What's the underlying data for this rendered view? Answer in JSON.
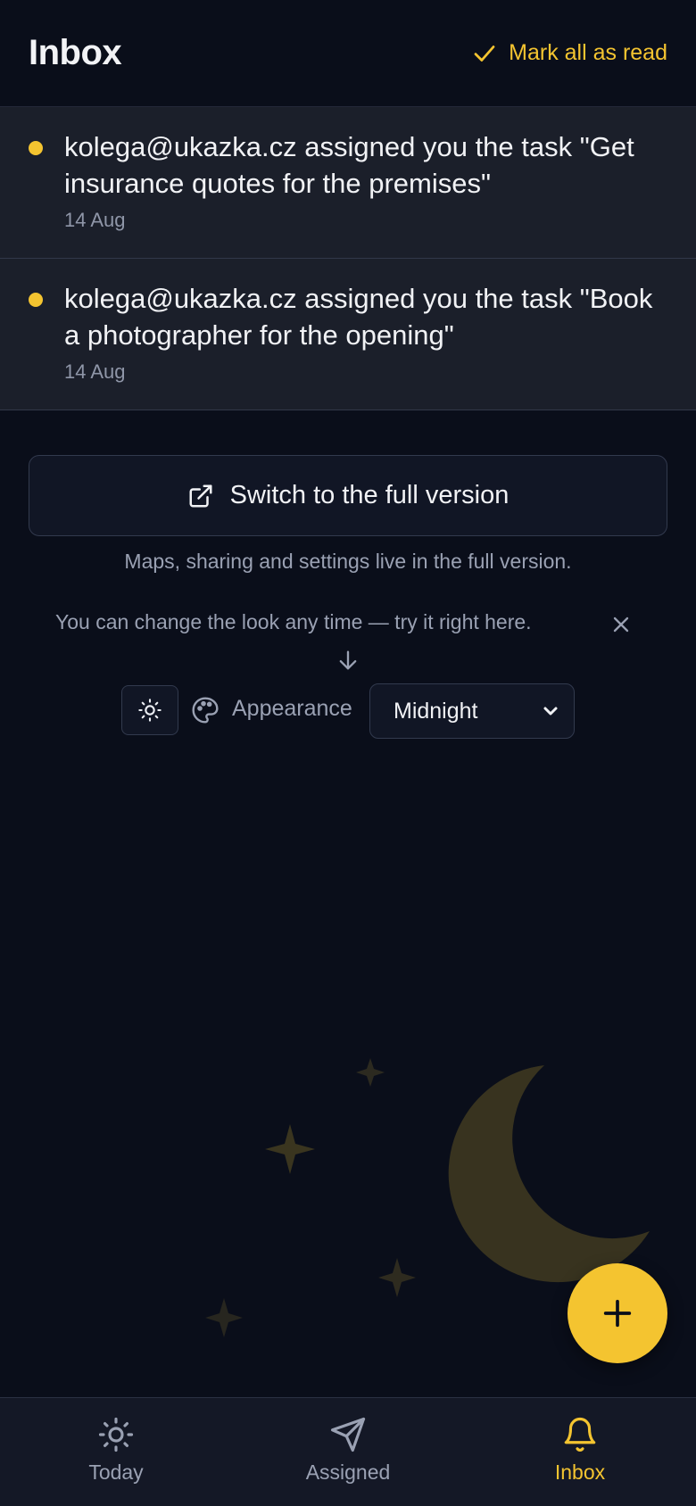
{
  "header": {
    "title": "Inbox",
    "mark_all_label": "Mark all as read"
  },
  "notifications": [
    {
      "text": "kolega@ukazka.cz assigned you the task \"Get insurance quotes for the premises\"",
      "date": "14 Aug",
      "unread": true
    },
    {
      "text": "kolega@ukazka.cz assigned you the task \"Book a photographer for the opening\"",
      "date": "14 Aug",
      "unread": true
    }
  ],
  "full_version": {
    "button_label": "Switch to the full version",
    "note": "Maps, sharing and settings live in the full version."
  },
  "tip": {
    "text": "You can change the look any time — try it right here."
  },
  "appearance": {
    "label": "Appearance",
    "selected": "Midnight"
  },
  "bottom_nav": {
    "items": [
      {
        "label": "Today",
        "icon": "sun-icon",
        "active": false
      },
      {
        "label": "Assigned",
        "icon": "send-icon",
        "active": false
      },
      {
        "label": "Inbox",
        "icon": "bell-icon",
        "active": true
      }
    ]
  },
  "colors": {
    "accent": "#f4c430",
    "background": "#0a0e1a",
    "card": "#1b1f2a"
  }
}
